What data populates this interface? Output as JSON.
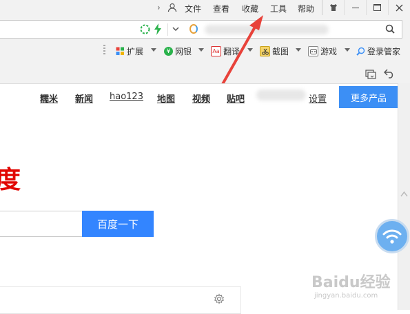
{
  "menu": {
    "items": [
      "文件",
      "查看",
      "收藏",
      "工具",
      "帮助"
    ]
  },
  "toolbar": {
    "items": [
      {
        "label": "扩展"
      },
      {
        "label": "网银"
      },
      {
        "label": "翻译"
      },
      {
        "label": "截图"
      },
      {
        "label": "游戏"
      },
      {
        "label": "登录管家"
      }
    ]
  },
  "nav": {
    "links": [
      "糯米",
      "新闻",
      "hao123",
      "地图",
      "视频",
      "贴吧"
    ],
    "settings": "设置",
    "more": "更多产品"
  },
  "logo_fragment": "度",
  "search": {
    "button": "百度一下",
    "placeholder": ""
  },
  "watermark": {
    "main": "Baidu经验",
    "sub": "jingyan.baidu.com"
  },
  "colors": {
    "accent": "#3c8ff5",
    "arrow": "#e8423a",
    "logo": "#e10602"
  }
}
